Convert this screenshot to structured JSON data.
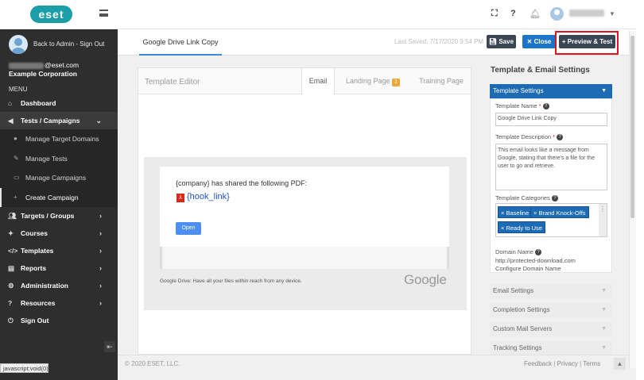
{
  "topbar": {
    "logo_text": "eset",
    "icons": [
      "expand-icon",
      "help-icon",
      "bell-icon"
    ],
    "help_glyph": "?"
  },
  "sidebar": {
    "back_admin": "Back to Admin - Sign Out",
    "email_suffix": "@eset.com",
    "org": "Example Corporation",
    "menu_label": "MENU",
    "items": [
      {
        "label": "Dashboard",
        "icon": "dashboard-icon"
      },
      {
        "label": "Tests / Campaigns",
        "icon": "megaphone-icon",
        "expanded": true
      },
      {
        "label": "Targets / Groups",
        "icon": "users-icon"
      },
      {
        "label": "Courses",
        "icon": "courses-icon"
      },
      {
        "label": "Templates",
        "icon": "code-icon"
      },
      {
        "label": "Reports",
        "icon": "reports-icon"
      },
      {
        "label": "Administration",
        "icon": "gear-icon"
      },
      {
        "label": "Resources",
        "icon": "help-circle-icon"
      },
      {
        "label": "Sign Out",
        "icon": "power-icon"
      }
    ],
    "sub_items": [
      {
        "label": "Manage Target Domains"
      },
      {
        "label": "Manage Tests"
      },
      {
        "label": "Manage Campaigns"
      },
      {
        "label": "Create Campaign",
        "active": true
      }
    ]
  },
  "header": {
    "doc_tab": "Google Drive Link Copy",
    "last_saved": "Last Saved: 7/17/2020 9:54 PM",
    "save_label": "Save",
    "close_label": "Close",
    "preview_label": "Preview & Test"
  },
  "editor": {
    "title": "Template Editor",
    "tabs": {
      "email": "Email",
      "landing": "Landing Page",
      "landing_badge": "1",
      "training": "Training Page"
    },
    "email_line": "{company} has shared the following PDF:",
    "hook_link": "{hook_link}",
    "open_button": "Open",
    "footer_text": "Google Drive: Have all your files within reach from any device.",
    "google": "Google"
  },
  "right_panel": {
    "title": "Template & Email Settings",
    "section": "Template Settings",
    "template_name_label": "Template Name",
    "template_name_value": "Google Drive Link Copy",
    "template_desc_label": "Template Description",
    "template_desc_value": "This email looks like a message from Google, stating that there's a file for the user to go and retrieve.",
    "categories_label": "Template Categories",
    "categories": [
      "Baseline",
      "Brand Knock-Offs",
      "Ready to Use"
    ],
    "domain_label": "Domain Name",
    "domain_value": "http://protected-download.com",
    "domain_config": "Configure Domain Name",
    "collapsed_sections": [
      "Email Settings",
      "Completion Settings",
      "Custom Mail Servers",
      "Tracking Settings"
    ]
  },
  "footer": {
    "copyright": "© 2020 ESET, LLC.",
    "links": [
      "Feedback",
      "Privacy",
      "Terms"
    ]
  },
  "status_bar": "javascript:void(0)"
}
